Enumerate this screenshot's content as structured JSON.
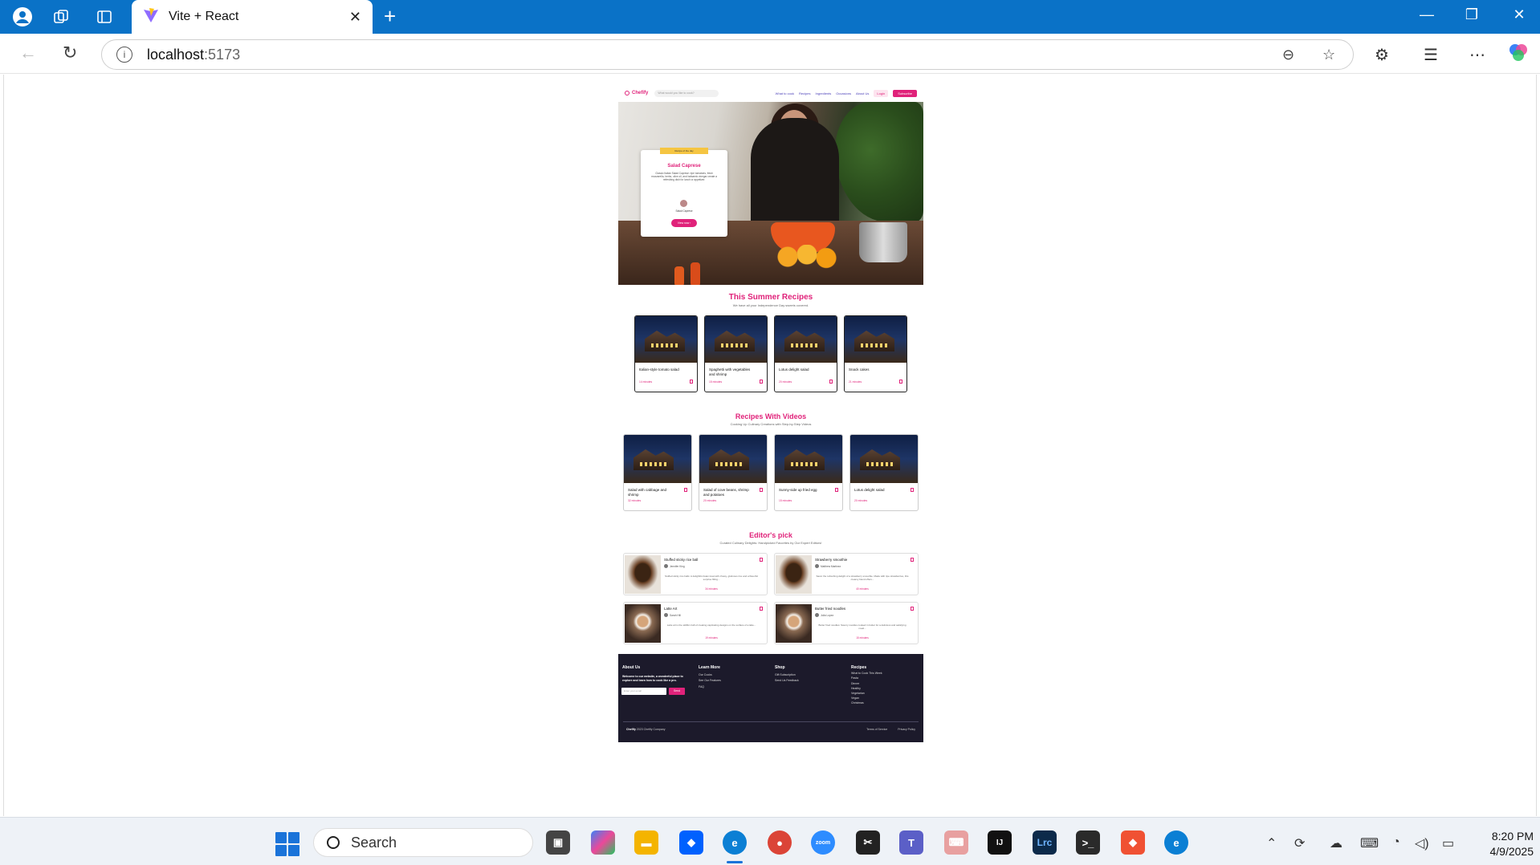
{
  "browser": {
    "tab_title": "Vite + React",
    "url_host": "localhost",
    "url_port": ":5173"
  },
  "site": {
    "logo": "Chefify",
    "search_placeholder": "What would you like to cook?",
    "nav": [
      "What to cook",
      "Recipes",
      "Ingredients",
      "Occasions",
      "About Us"
    ],
    "login": "Login",
    "subscribe": "Subscribe",
    "hero": {
      "badge": "Recipe of the day",
      "title": "Salad Caprese",
      "description": "Classic Italian Salad Caprese: ripe tomatoes, fresh mozzarella, herbs, olive oil, and balsamic vinegar create a refreshing dish for lunch or appetizer.",
      "author": "Salad Caprese",
      "button": "View now"
    },
    "summer": {
      "title": "This Summer Recipes",
      "subtitle": "We have all your Independence Day sweets covered.",
      "cards": [
        {
          "name": "Italian-style tomato salad",
          "time": "14 minutes"
        },
        {
          "name": "Spaghetti with vegetables and shrimp",
          "time": "15 minutes"
        },
        {
          "name": "Lotus delight salad",
          "time": "20 minutes"
        },
        {
          "name": "Snack cakes",
          "time": "21 minutes"
        }
      ]
    },
    "videos": {
      "title": "Recipes With Videos",
      "subtitle": "Cooking Up Culinary Creations with Step-by-Step Videos",
      "cards": [
        {
          "name": "Salad with cabbage and shrimp",
          "time": "32 minutes"
        },
        {
          "name": "Salad of cove beans, shrimp and potatoes",
          "time": "20 minutes"
        },
        {
          "name": "Sunny-side up fried egg",
          "time": "15 minutes"
        },
        {
          "name": "Lotus delight salad",
          "time": "20 minutes"
        }
      ]
    },
    "editor": {
      "title": "Editor's pick",
      "subtitle": "Curated Culinary Delights: Handpicked Favorites by Our Expert Editors!",
      "cards": [
        {
          "title": "Stuffed sticky rice ball",
          "author": "Jennifer King",
          "desc": "Stuffed sticky rice balls: A delightful Asian treat with chewy, glutinous rice and a flavorful surprise filling...",
          "time": "34 minutes"
        },
        {
          "title": "Strawberry smoothie",
          "author": "Matthew Martinez",
          "desc": "Savor the refreshing delight of a strawberry smoothie. Made with ripe strawberries, this creamy blend offers...",
          "time": "40 minutes"
        },
        {
          "title": "Latte Art",
          "author": "Sarah Hill",
          "desc": "Latte art is the skillful craft of creating captivating designs on the surface of a latte...",
          "time": "19 minutes"
        },
        {
          "title": "Butter fried noodles",
          "author": "Julia Lopez",
          "desc": "Butter fried noodles: Savory noodles cooked in butter for a delicious and satisfying meal...",
          "time": "15 minutes"
        }
      ]
    },
    "footer": {
      "about_head": "About Us",
      "about_text": "Welcome to our website, a wonderful place to explore and learn how to cook like a pro.",
      "email_placeholder": "Enter your email",
      "send": "Send",
      "learn_head": "Learn More",
      "learn_links": [
        "Our Cooks",
        "See Our Features",
        "FAQ"
      ],
      "shop_head": "Shop",
      "shop_links": [
        "Gift Subscription",
        "Send Us Feedback"
      ],
      "recipes_head": "Recipes",
      "recipes_links": [
        "What to Cook This Week",
        "Pasta",
        "Dinner",
        "Healthy",
        "Vegetarian",
        "Vegan",
        "Christmas"
      ],
      "brand": "Chefify",
      "copyright": "2023 Chefify Company",
      "terms": "Terms of Service",
      "privacy": "Privacy Policy"
    }
  },
  "taskbar": {
    "search": "Search",
    "time": "8:20 PM",
    "date": "4/9/2025"
  }
}
